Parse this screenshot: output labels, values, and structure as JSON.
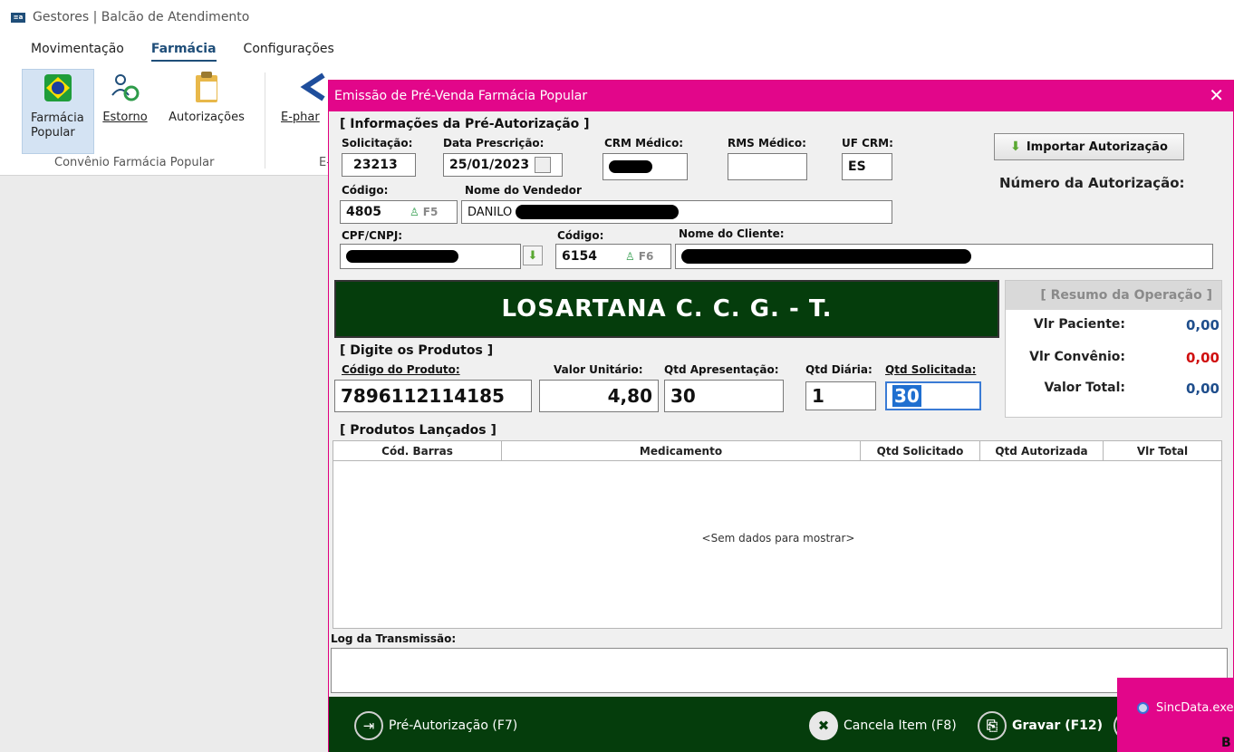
{
  "app": {
    "title": "Gestores | Balcão de Atendimento",
    "logo_text": "≡a",
    "menu_tabs": [
      "Movimentação",
      "Farmácia",
      "Configurações"
    ],
    "active_tab": "Farmácia"
  },
  "ribbon": {
    "buttons": [
      {
        "label": "Farmácia Popular",
        "icon": "brazil-flag-icon"
      },
      {
        "label": "Estorno",
        "icon": "users-refresh-icon"
      },
      {
        "label": "Autorizações",
        "icon": "clipboard-icon"
      },
      {
        "label": "E-phar",
        "icon": "e-pharma-icon"
      }
    ],
    "group_label": "Convênio Farmácia Popular",
    "group_label_2": "E-"
  },
  "dialog": {
    "title": "Emissão de Pré-Venda Farmácia Popular",
    "close_label": "✕",
    "pre_auth_section": "[ Informações da Pré-Autorização ]",
    "solicitacao_label": "Solicitação:",
    "solicitacao_value": "23213",
    "data_prescricao_label": "Data Prescrição:",
    "data_prescricao_value": "25/01/2023",
    "crm_medico_label": "CRM Médico:",
    "rms_medico_label": "RMS Médico:",
    "rms_medico_value": "",
    "uf_crm_label": "UF CRM:",
    "uf_crm_value": "ES",
    "importar_button": "Importar Autorização",
    "numero_autorizacao_label": "Número da Autorização:",
    "codigo_vendedor_label": "Código:",
    "codigo_vendedor_value": "4805",
    "f5_label": "F5",
    "nome_vendedor_label": "Nome do Vendedor",
    "nome_vendedor_value": "DANILO",
    "cpf_label": "CPF/CNPJ:",
    "codigo_cliente_label": "Código:",
    "codigo_cliente_value": "6154",
    "f6_label": "F6",
    "nome_cliente_label": "Nome do Cliente:",
    "product_name": "LOSARTANA C. C. G. - T.",
    "resumo": {
      "title": "[ Resumo da Operação ]",
      "vlr_paciente_label": "Vlr Paciente:",
      "vlr_paciente_value": "0,00",
      "vlr_convenio_label": "Vlr Convênio:",
      "vlr_convenio_value": "0,00",
      "valor_total_label": "Valor Total:",
      "valor_total_value": "0,00",
      "colors": {
        "paciente": "#1f4e8c",
        "convenio": "#d01010",
        "total": "#1f4e8c"
      }
    },
    "produtos_section": "[ Digite os Produtos ]",
    "codigo_produto_label": "Código do Produto:",
    "codigo_produto_value": "7896112114185",
    "valor_unitario_label": "Valor Unitário:",
    "valor_unitario_value": "4,80",
    "qtd_apresentacao_label": "Qtd Apresentação:",
    "qtd_apresentacao_value": "30",
    "qtd_diaria_label": "Qtd Diária:",
    "qtd_diaria_value": "1",
    "qtd_solicitada_label": "Qtd Solicitada:",
    "qtd_solicitada_value": "30",
    "lancados_section": "[ Produtos Lançados ]",
    "grid_columns": [
      "Cód. Barras",
      "Medicamento",
      "Qtd Solicitado",
      "Qtd Autorizada",
      "Vlr Total"
    ],
    "grid_empty": "<Sem dados para mostrar>",
    "log_label": "Log da Transmissão:",
    "footer": {
      "pre_autorizacao": "Pré-Autorização (F7)",
      "cancela_item": "Cancela Item (F8)",
      "gravar": "Gravar (F12)"
    }
  },
  "notification": {
    "title": "SincData.exe",
    "avatar_letter": "i",
    "text_fragment": "B"
  },
  "colors": {
    "dialog_title": "#e2068a",
    "dark_green": "#053d0c",
    "ribbon_active": "#d4e3f3"
  }
}
